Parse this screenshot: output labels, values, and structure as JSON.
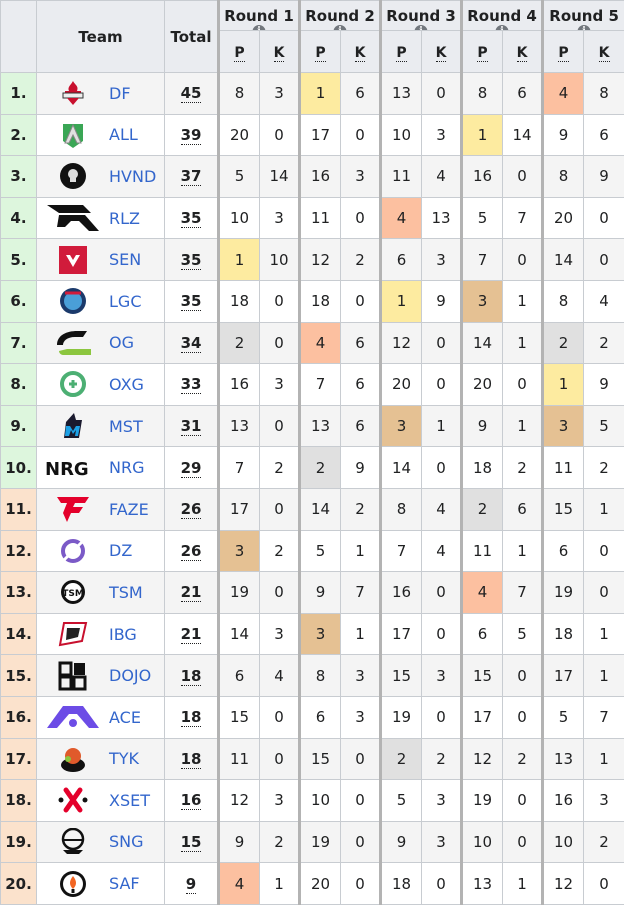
{
  "header": {
    "team_label": "Team",
    "total_label": "Total",
    "rounds": [
      "Round 1",
      "Round 2",
      "Round 3",
      "Round 4",
      "Round 5"
    ],
    "info_glyph": "i",
    "placement_label": "P",
    "kills_label": "K"
  },
  "highlight_colors": {
    "gold": "#fdeba0",
    "peach": "#fcc0a0",
    "bronze": "#e5c193",
    "gray": "#e0e0e0",
    "rank_green": "#ddf6dd",
    "rank_orange": "#fbe2cc",
    "link": "#3366cc"
  },
  "rows": [
    {
      "rank": "1.",
      "team": "DF",
      "logo": "df-logo",
      "total": "45",
      "rank_color": "green",
      "rounds": [
        [
          "8",
          "3",
          ""
        ],
        [
          "1",
          "6",
          "gold"
        ],
        [
          "13",
          "0",
          ""
        ],
        [
          "8",
          "6",
          ""
        ],
        [
          "4",
          "8",
          "peach"
        ]
      ]
    },
    {
      "rank": "2.",
      "team": "ALL",
      "logo": "all-logo",
      "total": "39",
      "rank_color": "green",
      "rounds": [
        [
          "20",
          "0",
          ""
        ],
        [
          "17",
          "0",
          ""
        ],
        [
          "10",
          "3",
          ""
        ],
        [
          "1",
          "14",
          "gold"
        ],
        [
          "9",
          "6",
          ""
        ]
      ]
    },
    {
      "rank": "3.",
      "team": "HVND",
      "logo": "hvnd-logo",
      "total": "37",
      "rank_color": "green",
      "rounds": [
        [
          "5",
          "14",
          ""
        ],
        [
          "16",
          "3",
          ""
        ],
        [
          "11",
          "4",
          ""
        ],
        [
          "16",
          "0",
          ""
        ],
        [
          "8",
          "9",
          ""
        ]
      ]
    },
    {
      "rank": "4.",
      "team": "RLZ",
      "logo": "rlz-logo",
      "total": "35",
      "rank_color": "green",
      "rounds": [
        [
          "10",
          "3",
          ""
        ],
        [
          "11",
          "0",
          ""
        ],
        [
          "4",
          "13",
          "peach"
        ],
        [
          "5",
          "7",
          ""
        ],
        [
          "20",
          "0",
          ""
        ]
      ]
    },
    {
      "rank": "5.",
      "team": "SEN",
      "logo": "sen-logo",
      "total": "35",
      "rank_color": "green",
      "rounds": [
        [
          "1",
          "10",
          "gold"
        ],
        [
          "12",
          "2",
          ""
        ],
        [
          "6",
          "3",
          ""
        ],
        [
          "7",
          "0",
          ""
        ],
        [
          "14",
          "0",
          ""
        ]
      ]
    },
    {
      "rank": "6.",
      "team": "LGC",
      "logo": "lgc-logo",
      "total": "35",
      "rank_color": "green",
      "rounds": [
        [
          "18",
          "0",
          ""
        ],
        [
          "18",
          "0",
          ""
        ],
        [
          "1",
          "9",
          "gold"
        ],
        [
          "3",
          "1",
          "bronze"
        ],
        [
          "8",
          "4",
          ""
        ]
      ]
    },
    {
      "rank": "7.",
      "team": "OG",
      "logo": "og-logo",
      "total": "34",
      "rank_color": "green",
      "rounds": [
        [
          "2",
          "0",
          "gray"
        ],
        [
          "4",
          "6",
          "peach"
        ],
        [
          "12",
          "0",
          ""
        ],
        [
          "14",
          "1",
          ""
        ],
        [
          "2",
          "2",
          "gray"
        ]
      ]
    },
    {
      "rank": "8.",
      "team": "OXG",
      "logo": "oxg-logo",
      "total": "33",
      "rank_color": "green",
      "rounds": [
        [
          "16",
          "3",
          ""
        ],
        [
          "7",
          "6",
          ""
        ],
        [
          "20",
          "0",
          ""
        ],
        [
          "20",
          "0",
          ""
        ],
        [
          "1",
          "9",
          "gold"
        ]
      ]
    },
    {
      "rank": "9.",
      "team": "MST",
      "logo": "mst-logo",
      "total": "31",
      "rank_color": "green",
      "rounds": [
        [
          "13",
          "0",
          ""
        ],
        [
          "13",
          "6",
          ""
        ],
        [
          "3",
          "1",
          "bronze"
        ],
        [
          "9",
          "1",
          ""
        ],
        [
          "3",
          "5",
          "bronze"
        ]
      ]
    },
    {
      "rank": "10.",
      "team": "NRG",
      "logo": "nrg-logo",
      "total": "29",
      "rank_color": "green",
      "rounds": [
        [
          "7",
          "2",
          ""
        ],
        [
          "2",
          "9",
          "gray"
        ],
        [
          "14",
          "0",
          ""
        ],
        [
          "18",
          "2",
          ""
        ],
        [
          "11",
          "2",
          ""
        ]
      ]
    },
    {
      "rank": "11.",
      "team": "FAZE",
      "logo": "faze-logo",
      "total": "26",
      "rank_color": "orange",
      "rounds": [
        [
          "17",
          "0",
          ""
        ],
        [
          "14",
          "2",
          ""
        ],
        [
          "8",
          "4",
          ""
        ],
        [
          "2",
          "6",
          "gray"
        ],
        [
          "15",
          "1",
          ""
        ]
      ]
    },
    {
      "rank": "12.",
      "team": "DZ",
      "logo": "dz-logo",
      "total": "26",
      "rank_color": "orange",
      "rounds": [
        [
          "3",
          "2",
          "bronze"
        ],
        [
          "5",
          "1",
          ""
        ],
        [
          "7",
          "4",
          ""
        ],
        [
          "11",
          "1",
          ""
        ],
        [
          "6",
          "0",
          ""
        ]
      ]
    },
    {
      "rank": "13.",
      "team": "TSM",
      "logo": "tsm-logo",
      "total": "21",
      "rank_color": "orange",
      "rounds": [
        [
          "19",
          "0",
          ""
        ],
        [
          "9",
          "7",
          ""
        ],
        [
          "16",
          "0",
          ""
        ],
        [
          "4",
          "7",
          "peach"
        ],
        [
          "19",
          "0",
          ""
        ]
      ]
    },
    {
      "rank": "14.",
      "team": "IBG",
      "logo": "ibg-logo",
      "total": "21",
      "rank_color": "orange",
      "rounds": [
        [
          "14",
          "3",
          ""
        ],
        [
          "3",
          "1",
          "bronze"
        ],
        [
          "17",
          "0",
          ""
        ],
        [
          "6",
          "5",
          ""
        ],
        [
          "18",
          "1",
          ""
        ]
      ]
    },
    {
      "rank": "15.",
      "team": "DOJO",
      "logo": "dojo-logo",
      "total": "18",
      "rank_color": "orange",
      "rounds": [
        [
          "6",
          "4",
          ""
        ],
        [
          "8",
          "3",
          ""
        ],
        [
          "15",
          "3",
          ""
        ],
        [
          "15",
          "0",
          ""
        ],
        [
          "17",
          "1",
          ""
        ]
      ]
    },
    {
      "rank": "16.",
      "team": "ACE",
      "logo": "ace-logo",
      "total": "18",
      "rank_color": "orange",
      "rounds": [
        [
          "15",
          "0",
          ""
        ],
        [
          "6",
          "3",
          ""
        ],
        [
          "19",
          "0",
          ""
        ],
        [
          "17",
          "0",
          ""
        ],
        [
          "5",
          "7",
          ""
        ]
      ]
    },
    {
      "rank": "17.",
      "team": "TYK",
      "logo": "tyk-logo",
      "total": "18",
      "rank_color": "orange",
      "rounds": [
        [
          "11",
          "0",
          ""
        ],
        [
          "15",
          "0",
          ""
        ],
        [
          "2",
          "2",
          "gray"
        ],
        [
          "12",
          "2",
          ""
        ],
        [
          "13",
          "1",
          ""
        ]
      ]
    },
    {
      "rank": "18.",
      "team": "XSET",
      "logo": "xset-logo",
      "total": "16",
      "rank_color": "orange",
      "rounds": [
        [
          "12",
          "3",
          ""
        ],
        [
          "10",
          "0",
          ""
        ],
        [
          "5",
          "3",
          ""
        ],
        [
          "19",
          "0",
          ""
        ],
        [
          "16",
          "3",
          ""
        ]
      ]
    },
    {
      "rank": "19.",
      "team": "SNG",
      "logo": "sng-logo",
      "total": "15",
      "rank_color": "orange",
      "rounds": [
        [
          "9",
          "2",
          ""
        ],
        [
          "19",
          "0",
          ""
        ],
        [
          "9",
          "3",
          ""
        ],
        [
          "10",
          "0",
          ""
        ],
        [
          "10",
          "2",
          ""
        ]
      ]
    },
    {
      "rank": "20.",
      "team": "SAF",
      "logo": "saf-logo",
      "total": "9",
      "rank_color": "orange",
      "rounds": [
        [
          "4",
          "1",
          "peach"
        ],
        [
          "20",
          "0",
          ""
        ],
        [
          "18",
          "0",
          ""
        ],
        [
          "13",
          "1",
          ""
        ],
        [
          "12",
          "0",
          ""
        ]
      ]
    }
  ]
}
